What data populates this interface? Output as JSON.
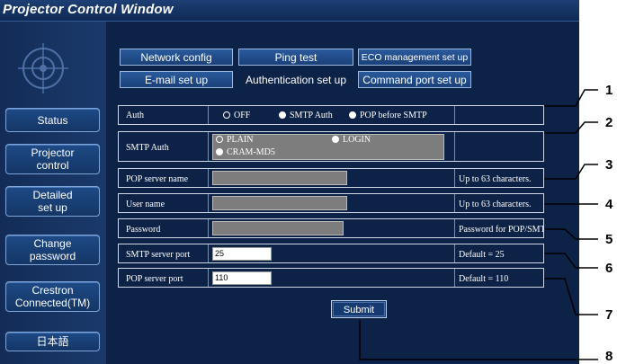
{
  "window": {
    "title": "Projector Control Window"
  },
  "sidebar": {
    "logo_icon": "network-globe-icon",
    "items": [
      {
        "label": "Status"
      },
      {
        "label": "Projector\ncontrol"
      },
      {
        "label": "Detailed\nset up"
      },
      {
        "label": "Change\npassword"
      },
      {
        "label": "Crestron\nConnected(TM)"
      },
      {
        "label": "日本語"
      }
    ]
  },
  "tabs": {
    "network_config": "Network config",
    "ping_test": "Ping test",
    "eco_management": "ECO management set up",
    "email_setup": "E-mail set up",
    "authentication_setup": "Authentication set up",
    "command_port_setup": "Command port set up",
    "active": "Authentication set up"
  },
  "form": {
    "auth": {
      "label": "Auth",
      "options": [
        "OFF",
        "SMTP Auth",
        "POP before SMTP"
      ],
      "selected": "OFF"
    },
    "smtp_auth": {
      "label": "SMTP Auth",
      "options": [
        "PLAIN",
        "LOGIN",
        "CRAM-MD5"
      ],
      "selected": "PLAIN"
    },
    "pop_server_name": {
      "label": "POP server name",
      "value": "",
      "note": "Up to 63 characters."
    },
    "user_name": {
      "label": "User name",
      "value": "",
      "note": "Up to 63 characters."
    },
    "password": {
      "label": "Password",
      "value": "",
      "note": "Password for POP/SMTP server"
    },
    "smtp_server_port": {
      "label": "SMTP server port",
      "value": "25",
      "note": "Default = 25"
    },
    "pop_server_port": {
      "label": "POP server port",
      "value": "110",
      "note": "Default = 110"
    },
    "submit_label": "Submit"
  },
  "callouts": [
    "1",
    "2",
    "3",
    "4",
    "5",
    "6",
    "7",
    "8"
  ]
}
